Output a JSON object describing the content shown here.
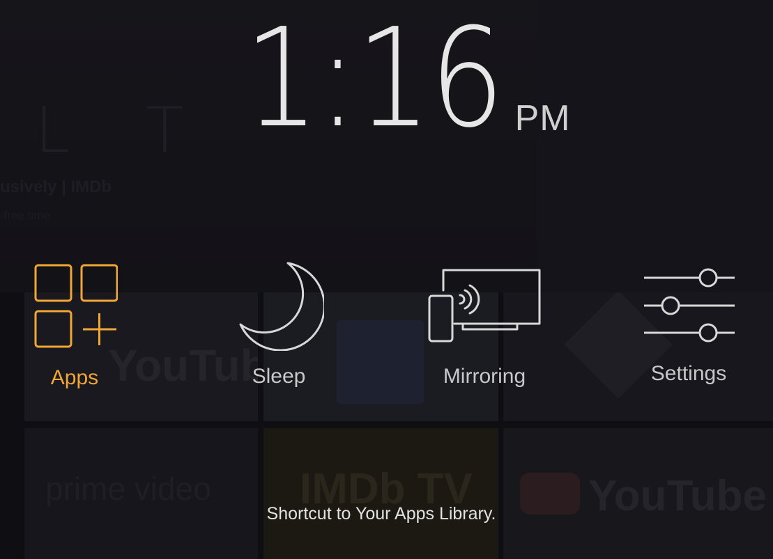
{
  "clock": {
    "time": "1:16",
    "meridiem": "PM"
  },
  "quick_menu": {
    "selected": "apps",
    "items": [
      {
        "id": "apps",
        "label": "Apps",
        "icon": "apps-grid-icon"
      },
      {
        "id": "sleep",
        "label": "Sleep",
        "icon": "moon-icon"
      },
      {
        "id": "mirroring",
        "label": "Mirroring",
        "icon": "screen-mirroring-icon"
      },
      {
        "id": "settings",
        "label": "Settings",
        "icon": "sliders-icon"
      }
    ]
  },
  "hint": "Shortcut to Your Apps Library.",
  "background": {
    "hero_logo": "L T",
    "hero_tag": "usively | IMDb",
    "hero_sub": "-free time",
    "tiles": [
      {
        "id": "youtube-1",
        "text": "YouTube"
      },
      {
        "id": "prime-video",
        "text": "prime video"
      },
      {
        "id": "imdb-tv",
        "text": "IMDb TV"
      },
      {
        "id": "youtube-2",
        "text": "YouTube"
      }
    ]
  },
  "colors": {
    "accent": "#f2a633",
    "label": "#c8c8c8",
    "icon": "#d8d8d8",
    "background": "#0f0e13"
  }
}
